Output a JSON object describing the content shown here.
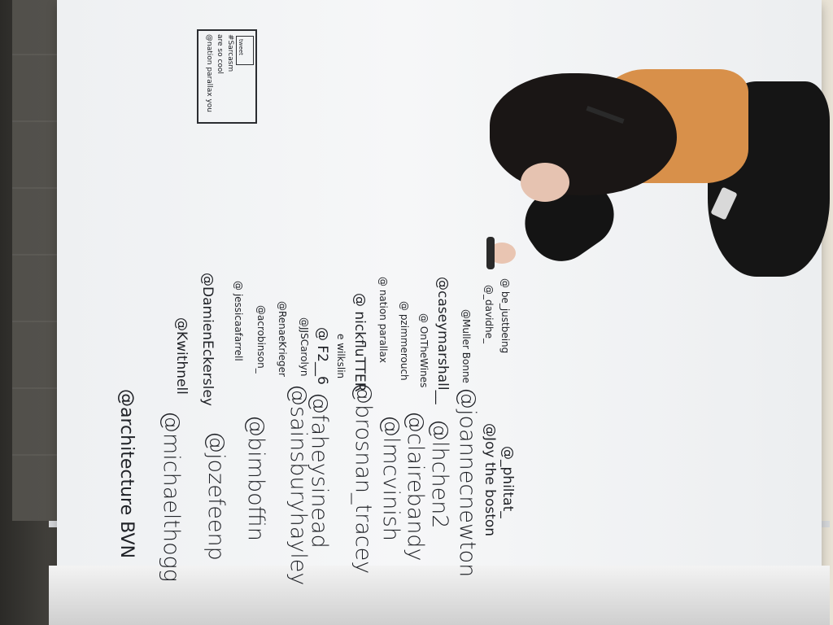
{
  "board": {
    "heading": "@architecture BVN",
    "column_one": [
      "@michaelthogg",
      "@jozefeenp",
      "@bimboffin",
      "@sainsburyhayley",
      "@faheysinead",
      "@brosnan_tracey",
      "@lmcvinish",
      "@clairebandy",
      "@lhchen2",
      "@joannecnewton",
      "@Joy the boston",
      "@_philtat_"
    ],
    "column_two": [
      "@Kwithnell",
      "@DamienEckersley",
      "@ jessicaafarrell",
      "@acrobinson_",
      "@RenaeKrieger",
      "@JJSCarolyn",
      "@ F2__6",
      "e wilkslin",
      "@ nickfluTTER",
      "@ nation parallax",
      "@ pzimmerouch",
      "@ OnTheWines",
      "@caseymarshall__",
      "@Muller Bonne",
      "@_davidhe_",
      "@ be_justbeing"
    ],
    "tweet_box": {
      "lines": [
        "@nation parallax you",
        "are so cool",
        "#Sarcasm"
      ],
      "button_label": "tweet"
    }
  },
  "colors": {
    "board": "#f2f3f4",
    "ink": "#23252a",
    "shirt": "#d8904a",
    "hair": "#1a1615"
  }
}
